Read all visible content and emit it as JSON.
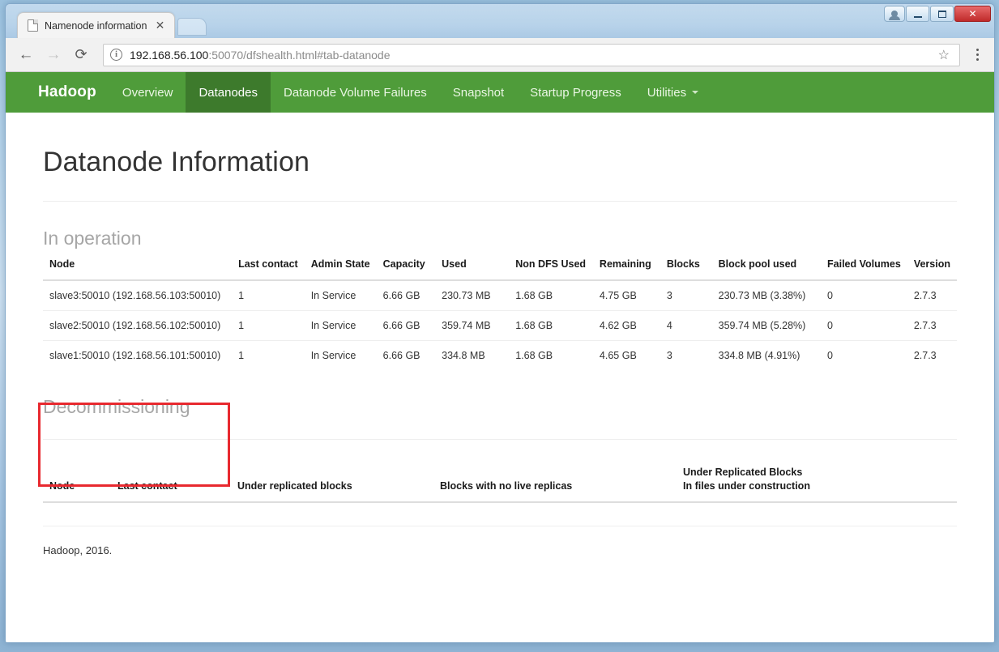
{
  "window": {
    "controls": [
      {
        "name": "user-account-button",
        "label": ""
      },
      {
        "name": "minimize-button",
        "label": ""
      },
      {
        "name": "maximize-button",
        "label": ""
      },
      {
        "name": "close-button",
        "label": "✕"
      }
    ]
  },
  "browser": {
    "tab": {
      "title": "Namenode information",
      "close_label": "✕",
      "favicon": "page-icon"
    },
    "new_tab_label": "",
    "nav": {
      "back": "←",
      "forward": "→",
      "reload": "⟳"
    },
    "omnibox": {
      "info_icon": "ⓘ",
      "url_host": "192.168.56.100",
      "url_rest": ":50070/dfshealth.html#tab-datanode",
      "full_url": "192.168.56.100:50070/dfshealth.html#tab-datanode",
      "star_icon": "☆"
    },
    "menu_icon": "kebab-menu-icon"
  },
  "hadoop": {
    "brand": "Hadoop",
    "nav_items": [
      {
        "label": "Overview",
        "active": false,
        "caret": false
      },
      {
        "label": "Datanodes",
        "active": true,
        "caret": false
      },
      {
        "label": "Datanode Volume Failures",
        "active": false,
        "caret": false
      },
      {
        "label": "Snapshot",
        "active": false,
        "caret": false
      },
      {
        "label": "Startup Progress",
        "active": false,
        "caret": false
      },
      {
        "label": "Utilities",
        "active": false,
        "caret": true
      }
    ],
    "accent_color": "#4f9c3a",
    "accent_active_color": "#3d7a2c"
  },
  "page": {
    "title": "Datanode Information",
    "in_operation": {
      "heading": "In operation",
      "columns": [
        "Node",
        "Last contact",
        "Admin State",
        "Capacity",
        "Used",
        "Non DFS Used",
        "Remaining",
        "Blocks",
        "Block pool used",
        "Failed Volumes",
        "Version"
      ],
      "rows": [
        {
          "node": "slave3:50010 (192.168.56.103:50010)",
          "last_contact": "1",
          "admin_state": "In Service",
          "capacity": "6.66 GB",
          "used": "230.73 MB",
          "non_dfs_used": "1.68 GB",
          "remaining": "4.75 GB",
          "blocks": "3",
          "block_pool_used": "230.73 MB (3.38%)",
          "failed_volumes": "0",
          "version": "2.7.3"
        },
        {
          "node": "slave2:50010 (192.168.56.102:50010)",
          "last_contact": "1",
          "admin_state": "In Service",
          "capacity": "6.66 GB",
          "used": "359.74 MB",
          "non_dfs_used": "1.68 GB",
          "remaining": "4.62 GB",
          "blocks": "4",
          "block_pool_used": "359.74 MB (5.28%)",
          "failed_volumes": "0",
          "version": "2.7.3"
        },
        {
          "node": "slave1:50010 (192.168.56.101:50010)",
          "last_contact": "1",
          "admin_state": "In Service",
          "capacity": "6.66 GB",
          "used": "334.8 MB",
          "non_dfs_used": "1.68 GB",
          "remaining": "4.65 GB",
          "blocks": "3",
          "block_pool_used": "334.8 MB (4.91%)",
          "failed_volumes": "0",
          "version": "2.7.3"
        }
      ]
    },
    "decommissioning": {
      "heading": "Decommissioning",
      "columns": [
        "Node",
        "Last contact",
        "Under replicated blocks",
        "Blocks with no live replicas"
      ],
      "column_two_line": {
        "line1": "Under Replicated Blocks",
        "line2": "In files under construction"
      },
      "rows": []
    },
    "footer": "Hadoop, 2016."
  },
  "annotation": {
    "highlight_color": "#e8292f",
    "target": "node-column-rows"
  }
}
